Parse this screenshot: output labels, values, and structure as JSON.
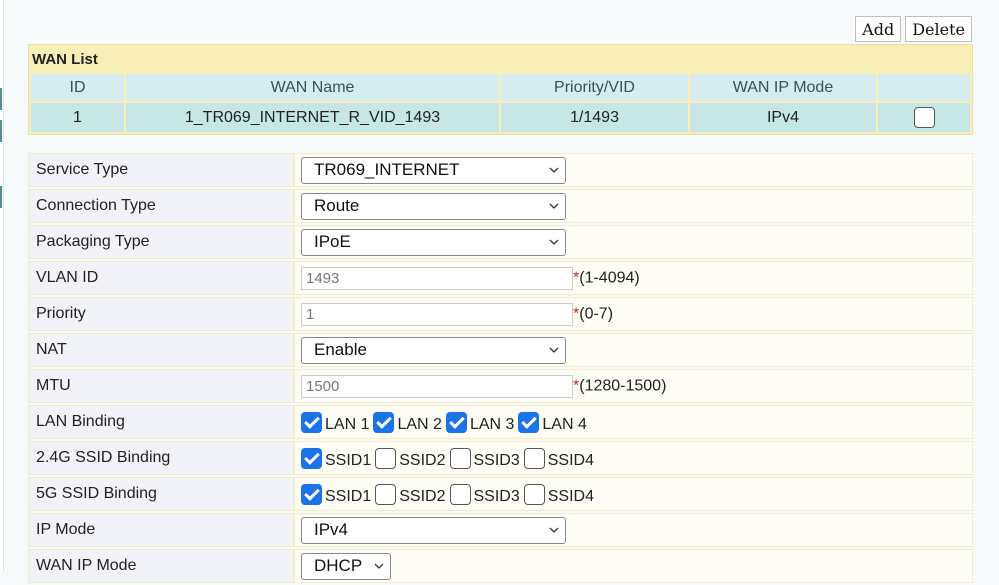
{
  "toolbar": {
    "add_label": "Add",
    "delete_label": "Delete"
  },
  "wan_list": {
    "title": "WAN List",
    "headers": [
      "ID",
      "WAN Name",
      "Priority/VID",
      "WAN IP Mode"
    ],
    "rows": [
      {
        "id": "1",
        "name": "1_TR069_INTERNET_R_VID_1493",
        "priority_vid": "1/1493",
        "ip_mode": "IPv4",
        "selected": false
      }
    ]
  },
  "form": {
    "service_type": {
      "label": "Service Type",
      "value": "TR069_INTERNET"
    },
    "connection_type": {
      "label": "Connection Type",
      "value": "Route"
    },
    "packaging_type": {
      "label": "Packaging Type",
      "value": "IPoE"
    },
    "vlan_id": {
      "label": "VLAN ID",
      "value": "1493",
      "required": "*",
      "range": "(1-4094)"
    },
    "priority": {
      "label": "Priority",
      "value": "1",
      "required": "*",
      "range": "(0-7)"
    },
    "nat": {
      "label": "NAT",
      "value": "Enable"
    },
    "mtu": {
      "label": "MTU",
      "value": "1500",
      "required": "*",
      "range": "(1280-1500)"
    },
    "lan_binding": {
      "label": "LAN Binding",
      "options": [
        {
          "label": "LAN 1",
          "checked": true
        },
        {
          "label": "LAN 2",
          "checked": true
        },
        {
          "label": "LAN 3",
          "checked": true
        },
        {
          "label": "LAN 4",
          "checked": true
        }
      ]
    },
    "ssid24_binding": {
      "label": "2.4G SSID Binding",
      "options": [
        {
          "label": "SSID1",
          "checked": true
        },
        {
          "label": "SSID2",
          "checked": false
        },
        {
          "label": "SSID3",
          "checked": false
        },
        {
          "label": "SSID4",
          "checked": false
        }
      ]
    },
    "ssid5_binding": {
      "label": "5G SSID Binding",
      "options": [
        {
          "label": "SSID1",
          "checked": true
        },
        {
          "label": "SSID2",
          "checked": false
        },
        {
          "label": "SSID3",
          "checked": false
        },
        {
          "label": "SSID4",
          "checked": false
        }
      ]
    },
    "ip_mode": {
      "label": "IP Mode",
      "value": "IPv4"
    },
    "wan_ip_mode": {
      "label": "WAN IP Mode",
      "value": "DHCP"
    }
  },
  "colors": {
    "checkbox_checked": "#1a73e8",
    "header_bg": "#f8eeb8",
    "row_bg": "#c7e7e7",
    "required_star": "#cc2222"
  },
  "icons": {
    "dropdown": "chevron-down-icon",
    "checkbox": "checkbox-icon"
  }
}
